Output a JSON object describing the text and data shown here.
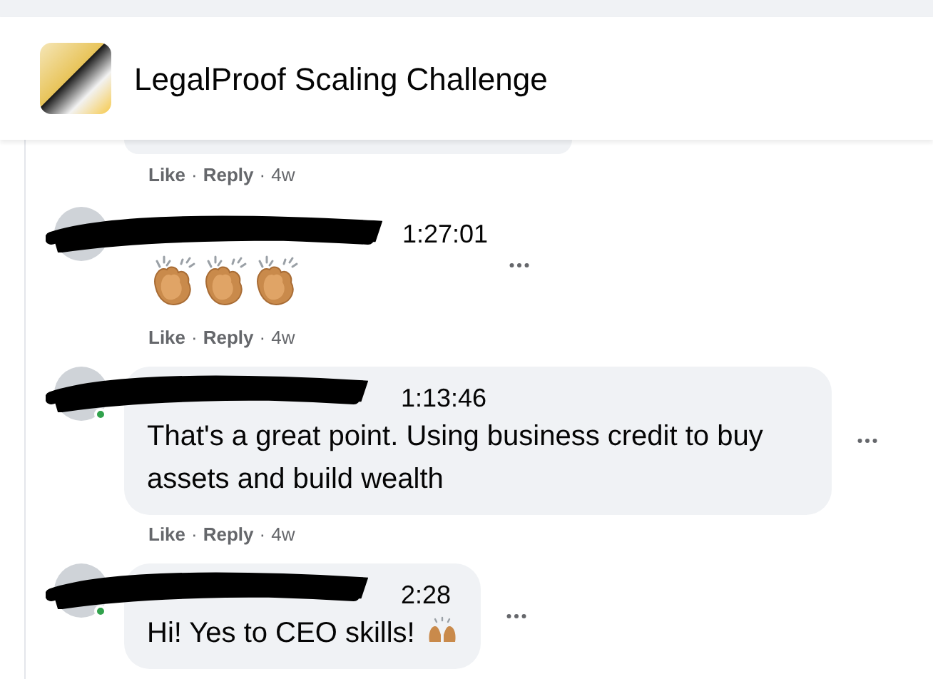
{
  "header": {
    "title": "LegalProof Scaling Challenge"
  },
  "comments": [
    {
      "kind": "cut",
      "actions": [
        {
          "kind": "link",
          "text": "Like"
        },
        {
          "kind": "sep",
          "text": "·"
        },
        {
          "kind": "link",
          "text": "Reply"
        },
        {
          "kind": "sep",
          "text": "·"
        },
        {
          "kind": "age",
          "text": "4w"
        }
      ]
    },
    {
      "kind": "emoji",
      "time": "1:27:01",
      "online": false,
      "actions": [
        {
          "kind": "link",
          "text": "Like"
        },
        {
          "kind": "sep",
          "text": "·"
        },
        {
          "kind": "link",
          "text": "Reply"
        },
        {
          "kind": "sep",
          "text": "·"
        },
        {
          "kind": "age",
          "text": "4w"
        }
      ]
    },
    {
      "kind": "text",
      "time": "1:13:46",
      "online": true,
      "text": "That's a great point. Using business credit to buy assets and build wealth",
      "emoji_after": false,
      "actions": [
        {
          "kind": "link",
          "text": "Like"
        },
        {
          "kind": "sep",
          "text": "·"
        },
        {
          "kind": "link",
          "text": "Reply"
        },
        {
          "kind": "sep",
          "text": "·"
        },
        {
          "kind": "age",
          "text": "4w"
        }
      ]
    },
    {
      "kind": "text",
      "time": "2:28",
      "online": true,
      "text": "Hi! Yes to CEO skills!",
      "emoji_after": true
    }
  ]
}
